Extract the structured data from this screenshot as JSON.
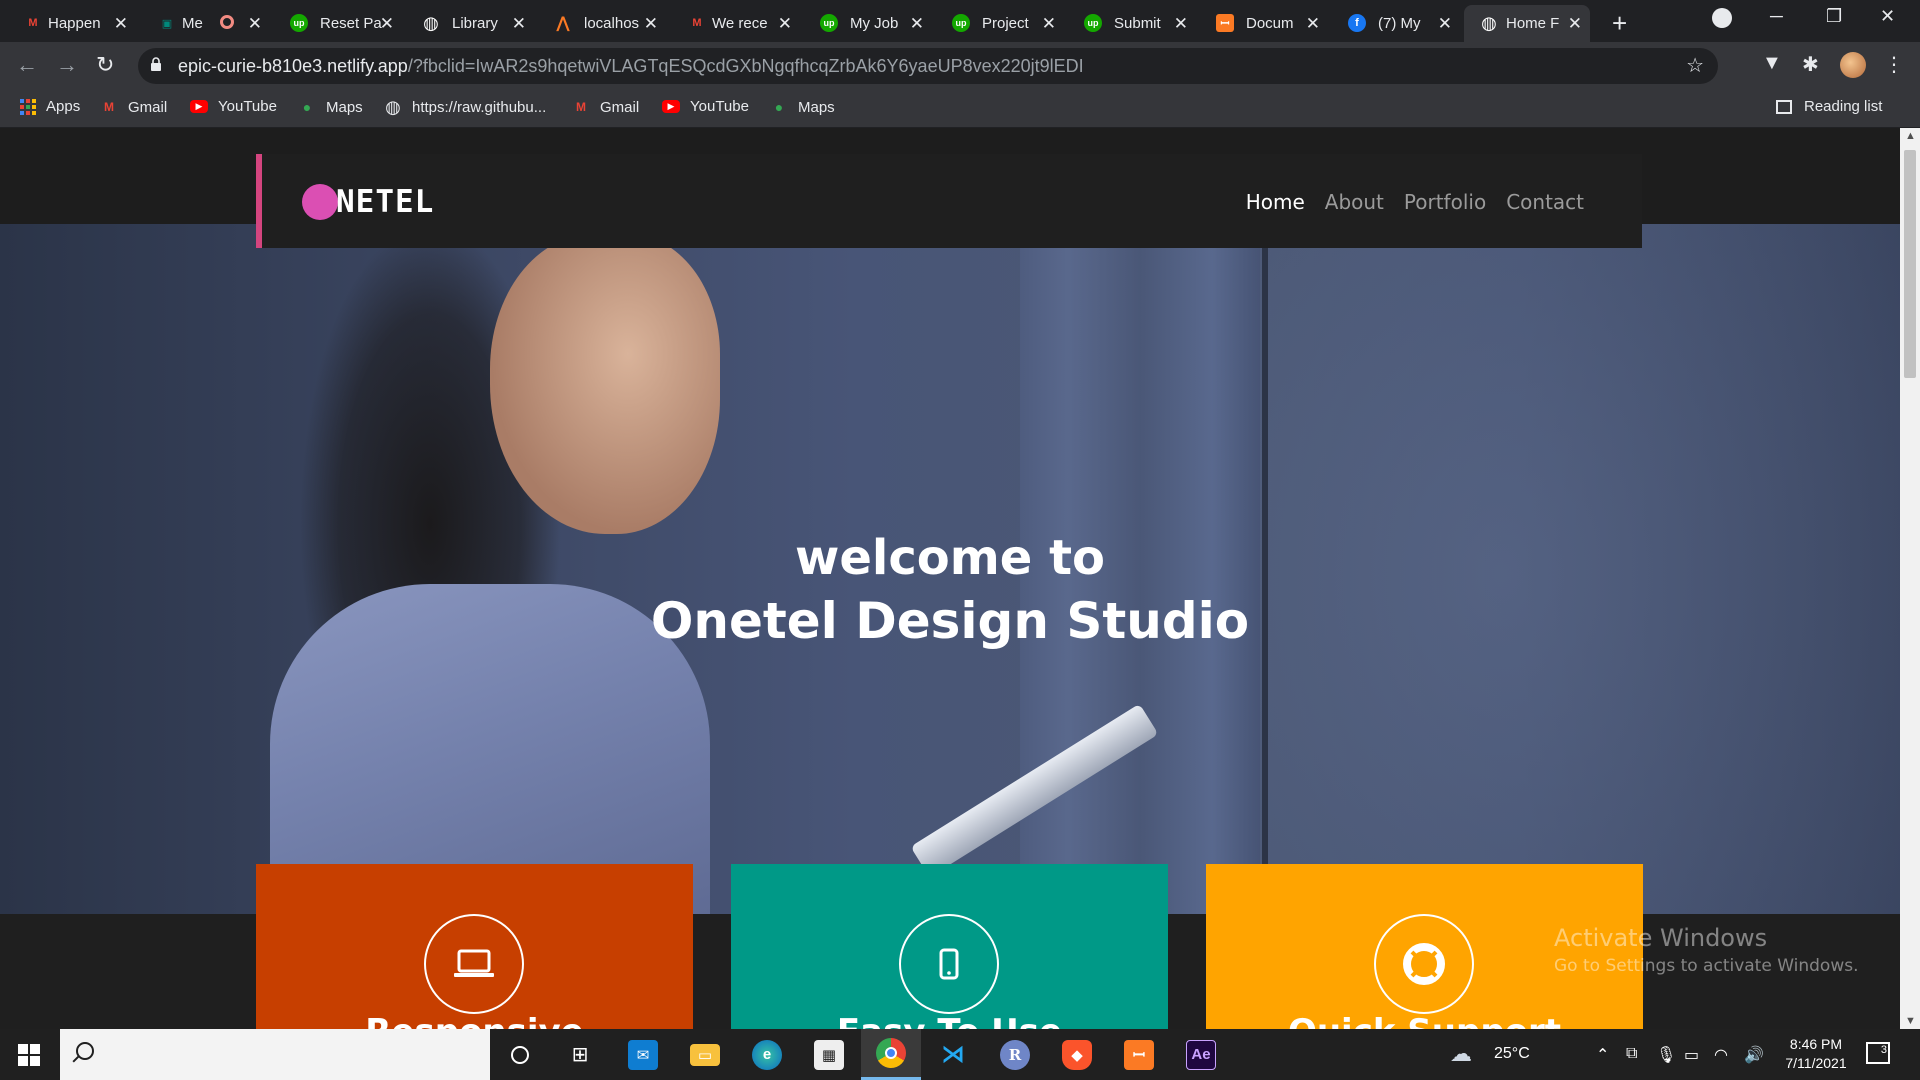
{
  "browser": {
    "tabs": [
      {
        "title": "Happen",
        "favicon": "gmail-icon",
        "color": "#ea4335",
        "glyph": "M"
      },
      {
        "title": "Me",
        "favicon": "google-meet-icon",
        "color": "#00897b",
        "glyph": "▣"
      },
      {
        "title": "Reset Pa",
        "favicon": "upwork-icon",
        "color": "#14a800",
        "glyph": "up"
      },
      {
        "title": "Library",
        "favicon": "globe-icon",
        "color": "#ffffff",
        "glyph": "◍"
      },
      {
        "title": "localhos",
        "favicon": "xampp-icon",
        "color": "#fb7a24",
        "glyph": "⋀"
      },
      {
        "title": "We rece",
        "favicon": "gmail-icon",
        "color": "#ea4335",
        "glyph": "M"
      },
      {
        "title": "My Job",
        "favicon": "upwork-icon",
        "color": "#14a800",
        "glyph": "up"
      },
      {
        "title": "Project",
        "favicon": "upwork-icon",
        "color": "#14a800",
        "glyph": "up"
      },
      {
        "title": "Submit",
        "favicon": "upwork-icon",
        "color": "#14a800",
        "glyph": "up"
      },
      {
        "title": "Docum",
        "favicon": "xampp-icon",
        "color": "#fb7a24",
        "glyph": "ꟷ"
      },
      {
        "title": "(7) My",
        "favicon": "facebook-icon",
        "color": "#1877f2",
        "glyph": "f"
      },
      {
        "title": "Home F",
        "favicon": "globe-icon",
        "color": "#ffffff",
        "glyph": "◍"
      }
    ],
    "url_host": "epic-curie-b810e3.netlify.app",
    "url_rest": "/?fbclid=IwAR2s9hqetwiVLAGTqESQcdGXbNgqfhcqZrbAk6Y6yaeUP8vex220jt9lEDI",
    "bookmarks": [
      {
        "label": "Apps",
        "icon": "apps-icon"
      },
      {
        "label": "Gmail",
        "icon": "gmail-icon",
        "glyph": "M",
        "color": "#ea4335"
      },
      {
        "label": "YouTube",
        "icon": "youtube-icon",
        "glyph": "▶",
        "color": "#ff0000"
      },
      {
        "label": "Maps",
        "icon": "maps-icon",
        "glyph": "●",
        "color": "#34a853"
      },
      {
        "label": "https://raw.githubu...",
        "icon": "globe-icon",
        "glyph": "◍",
        "color": "#e8eaed"
      },
      {
        "label": "Gmail",
        "icon": "gmail-icon",
        "glyph": "M",
        "color": "#ea4335"
      },
      {
        "label": "YouTube",
        "icon": "youtube-icon",
        "glyph": "▶",
        "color": "#ff0000"
      },
      {
        "label": "Maps",
        "icon": "maps-icon",
        "glyph": "●",
        "color": "#34a853"
      }
    ],
    "reading_list": "Reading list"
  },
  "site": {
    "logo_text": "NETEL",
    "logo_color": "#db4fb3",
    "nav": [
      "Home",
      "About",
      "Portfolio",
      "Contact"
    ],
    "hero_line1": "welcome to",
    "hero_line2": "Onetel Design Studio",
    "cards": [
      {
        "icon": "laptop-icon",
        "title": "Responsive",
        "color": "#c73f00"
      },
      {
        "icon": "mobile-icon",
        "title": "Easy To Use",
        "color": "#009987"
      },
      {
        "icon": "lifebuoy-icon",
        "title": "Quick Support",
        "color": "#ffa400"
      }
    ]
  },
  "watermark": {
    "line1": "Activate Windows",
    "line2": "Go to Settings to activate Windows."
  },
  "taskbar": {
    "weather": "25°C",
    "time": "8:46 PM",
    "date": "7/11/2021",
    "notifications": "3"
  }
}
